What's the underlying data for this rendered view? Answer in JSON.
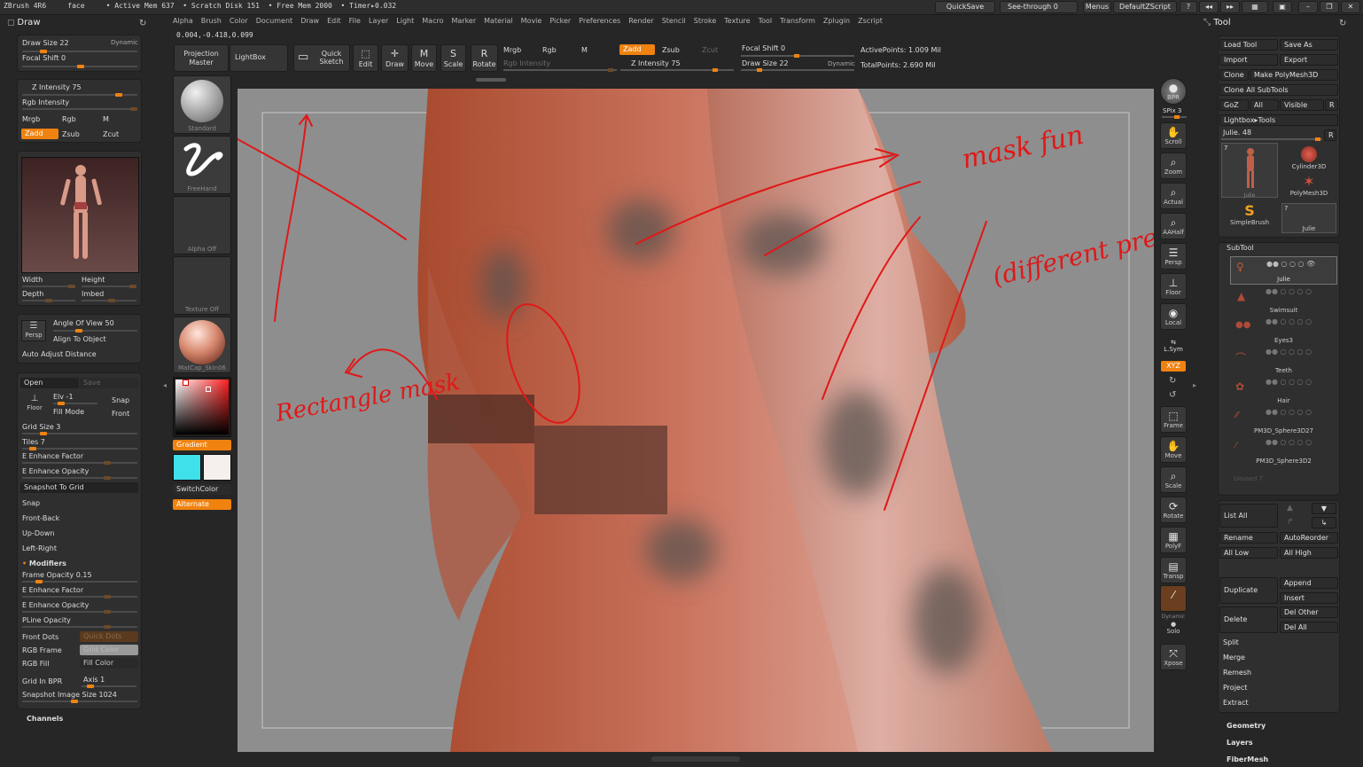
{
  "titlebar": {
    "info": "ZBrush 4R6     face     • Active Mem 637  • Scratch Disk 151  • Free Mem 2000  • Timer▸0.032",
    "quicksave": "QuickSave",
    "see_through": "See-through  0",
    "menus": "Menus",
    "default_zscript": "DefaultZScript"
  },
  "menubar": [
    "Alpha",
    "Brush",
    "Color",
    "Document",
    "Draw",
    "Edit",
    "File",
    "Layer",
    "Light",
    "Macro",
    "Marker",
    "Material",
    "Movie",
    "Picker",
    "Preferences",
    "Render",
    "Stencil",
    "Stroke",
    "Texture",
    "Tool",
    "Transform",
    "Zplugin",
    "Zscript"
  ],
  "coords": "0.004,-0.418,0.099",
  "left": {
    "title": "Draw",
    "draw_size": "Draw Size 22",
    "dynamic": "Dynamic",
    "focal_shift": "Focal Shift 0",
    "z_intensity": "Z Intensity 75",
    "rgb_intensity": "Rgb Intensity",
    "mrgb": "Mrgb",
    "rgb": "Rgb",
    "m": "M",
    "zadd": "Zadd",
    "zsub": "Zsub",
    "zcut": "Zcut",
    "width": "Width",
    "height": "Height",
    "depth": "Depth",
    "imbed": "Imbed",
    "persp": "Persp",
    "angle_of_view": "Angle Of View 50",
    "align_to_object": "Align To Object",
    "auto_adjust": "Auto Adjust Distance",
    "open": "Open",
    "save": "Save",
    "elv": "Elv -1",
    "snap_dim": "Snap",
    "floor": "Floor",
    "fill_mode": "Fill Mode",
    "front": "Front",
    "grid_size": "Grid Size 3",
    "tiles": "Tiles 7",
    "e_enhance_factor": "E Enhance Factor",
    "e_enhance_opacity": "E Enhance Opacity",
    "snapshot_to_grid": "Snapshot To Grid",
    "snap": "Snap",
    "front_back": "Front-Back",
    "up_down": "Up-Down",
    "left_right": "Left-Right",
    "modifiers": "Modifiers",
    "frame_opacity": "Frame Opacity 0.15",
    "e_enhance_factor2": "E Enhance Factor",
    "e_enhance_opacity2": "E Enhance Opacity",
    "pline_opacity": "PLine Opacity",
    "front_dots": "Front Dots",
    "quick_dots": "Quick Dots",
    "rgb_frame": "RGB Frame",
    "grid_color": "Grid Color",
    "rgb_fill": "RGB Fill",
    "fill_color": "Fill Color",
    "grid_in_bpr": "Grid In BPR",
    "axis": "Axis 1",
    "snapshot_size": "Snapshot Image Size 1024",
    "channels": "Channels"
  },
  "toolcol": {
    "standard": "Standard",
    "freehand": "FreeHand",
    "alpha_off": "Alpha  Off",
    "texture_off": "Texture  Off",
    "matcap": "MatCap_Skin06",
    "gradient": "Gradient",
    "switchcolor": "SwitchColor",
    "alternate": "Alternate",
    "color_main": "#3fe0ea",
    "color_secondary": "#f5f0ee"
  },
  "shelf": {
    "projection_master": "Projection Master",
    "lightbox": "LightBox",
    "quick_sketch": "Quick Sketch",
    "edit": "Edit",
    "draw": "Draw",
    "move": "Move",
    "scale": "Scale",
    "rotate": "Rotate",
    "mrgb": "Mrgb",
    "rgb": "Rgb",
    "m": "M",
    "rgb_intensity": "Rgb Intensity",
    "zadd": "Zadd",
    "zsub": "Zsub",
    "zcut": "Zcut",
    "z_intensity": "Z Intensity 75",
    "focal_shift": "Focal Shift 0",
    "draw_size": "Draw Size 22",
    "dynamic": "Dynamic",
    "active_points": "ActivePoints: 1.009 Mil",
    "total_points": "TotalPoints: 2.690 Mil"
  },
  "annotations": {
    "mask_fun": "mask fun",
    "different_pressure": "(different pressure)",
    "rectangle_mask": "Rectangle mask"
  },
  "rightshelf": [
    "BPR",
    "SPix 3",
    "Scroll",
    "Zoom",
    "Actual",
    "AAHalf",
    "Persp",
    "Floor",
    "Local",
    "L.Sym",
    "XYZ",
    "",
    "",
    "Frame",
    "Move",
    "Scale",
    "Rotate",
    "PolyF",
    "Transp",
    "Dynamic",
    "Solo",
    "Xpose"
  ],
  "right": {
    "title": "Tool",
    "load_tool": "Load Tool",
    "save_as": "Save As",
    "import": "Import",
    "export": "Export",
    "clone": "Clone",
    "make_polymesh": "Make PolyMesh3D",
    "clone_all": "Clone  All SubTools",
    "goz": "GoZ",
    "all": "All",
    "visible": "Visible",
    "r": "R",
    "lightbox_tools": "Lightbox▸Tools",
    "julie": "Julie. 48",
    "r2": "R",
    "tools": [
      {
        "label": "Julie",
        "count": "7"
      },
      {
        "label": "Cylinder3D",
        "count": ""
      },
      {
        "label": "PolyMesh3D",
        "count": ""
      },
      {
        "label": "SimpleBrush",
        "count": ""
      },
      {
        "label": "Julie",
        "count": "7"
      }
    ],
    "subtool_title": "SubTool",
    "subtools": [
      "Julie",
      "Swimsuit",
      "Eyes3",
      "Teeth",
      "Hair",
      "PM3D_Sphere3D27",
      "PM3D_Sphere3D2"
    ],
    "unused": "Unused  7",
    "list_all": "List All",
    "rename": "Rename",
    "autoreorder": "AutoReorder",
    "all_low": "All Low",
    "all_high": "All High",
    "duplicate": "Duplicate",
    "append": "Append",
    "insert": "Insert",
    "delete": "Delete",
    "del_other": "Del Other",
    "del_all": "Del All",
    "split": "Split",
    "merge": "Merge",
    "remesh": "Remesh",
    "project": "Project",
    "extract": "Extract",
    "geometry": "Geometry",
    "layers": "Layers",
    "fibermesh": "FiberMesh"
  }
}
